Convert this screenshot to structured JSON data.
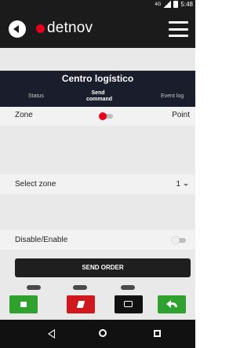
{
  "statusbar": {
    "network": "4G",
    "time": "5:48"
  },
  "appbar": {
    "brand": "detnov"
  },
  "panel": {
    "title": "Centro logístico",
    "tabs": {
      "status": "Status",
      "send": "Send command",
      "event": "Event log"
    }
  },
  "zone_row": {
    "label": "Zone",
    "value": "Point"
  },
  "select_row": {
    "label": "Select zone",
    "value": "1"
  },
  "disable_row": {
    "label": "Disable/Enable"
  },
  "send_order": {
    "label": "SEND ORDER"
  },
  "colors": {
    "brand_red": "#e8001c",
    "panel_bg": "#1a1d2b",
    "action_green": "#2fa12f",
    "action_red": "#d0191f"
  },
  "action_buttons": [
    {
      "icon": "mute-icon",
      "color": "green"
    },
    {
      "icon": "silence-alarm-icon",
      "color": "red"
    },
    {
      "icon": "reset-icon",
      "color": "dark"
    },
    {
      "icon": "back-arrow-icon",
      "color": "green"
    }
  ]
}
